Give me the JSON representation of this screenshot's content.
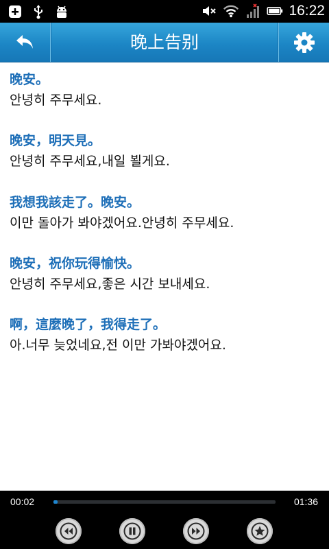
{
  "status_bar": {
    "time": "16:22",
    "left_icons": [
      "plus-icon",
      "usb-icon",
      "android-icon"
    ],
    "right_icons": [
      "mute-icon",
      "wifi-icon",
      "signal-icon",
      "battery-icon"
    ]
  },
  "header": {
    "title": "晚上告别",
    "back_icon": "back-arrow-icon",
    "settings_icon": "gear-icon",
    "accent": "#1c86c5"
  },
  "phrases": [
    {
      "zh": "晚安。",
      "ko": "안녕히 주무세요."
    },
    {
      "zh": "晚安，明天見。",
      "ko": "안녕히 주무세요,내일 뵐게요."
    },
    {
      "zh": "我想我該走了。晚安。",
      "ko": "이만 돌아가 봐야겠어요.안녕히 주무세요."
    },
    {
      "zh": "晚安，祝你玩得愉快。",
      "ko": "안녕히 주무세요,좋은 시간 보내세요."
    },
    {
      "zh": "啊，這麼晚了，我得走了。",
      "ko": "아.너무 늦었네요,전 이만 가봐야겠어요."
    }
  ],
  "player": {
    "current_time": "00:02",
    "total_time": "01:36",
    "progress": 0.02,
    "controls": [
      "rewind-icon",
      "pause-icon",
      "fast-forward-icon",
      "star-icon"
    ]
  }
}
